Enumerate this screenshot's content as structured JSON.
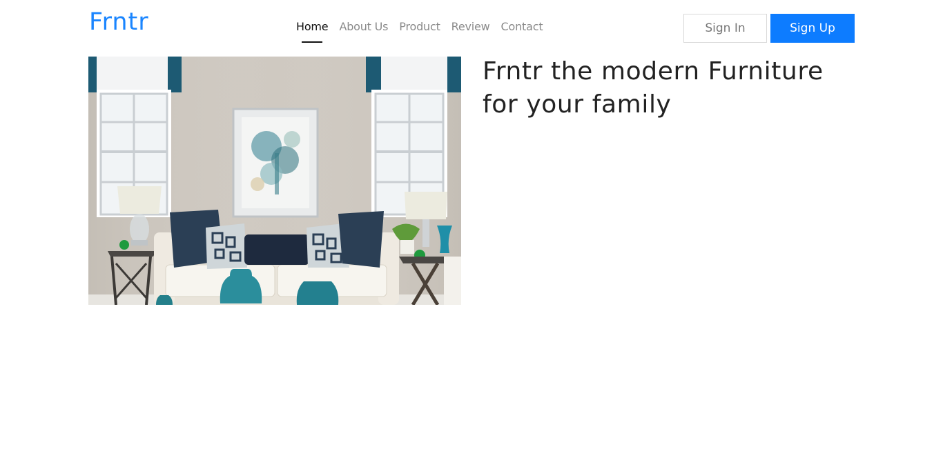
{
  "brand": {
    "logo_text": "Frntr",
    "color": "#1a85ff"
  },
  "nav": {
    "items": [
      {
        "label": "Home",
        "active": true
      },
      {
        "label": "About Us",
        "active": false
      },
      {
        "label": "Product",
        "active": false
      },
      {
        "label": "Review",
        "active": false
      },
      {
        "label": "Contact",
        "active": false
      }
    ]
  },
  "auth": {
    "signin_label": "Sign In",
    "signup_label": "Sign Up",
    "signup_color": "#0d7cff"
  },
  "hero": {
    "title": "Frntr the modern Furniture for your family",
    "image_icon": "living-room-photo"
  }
}
